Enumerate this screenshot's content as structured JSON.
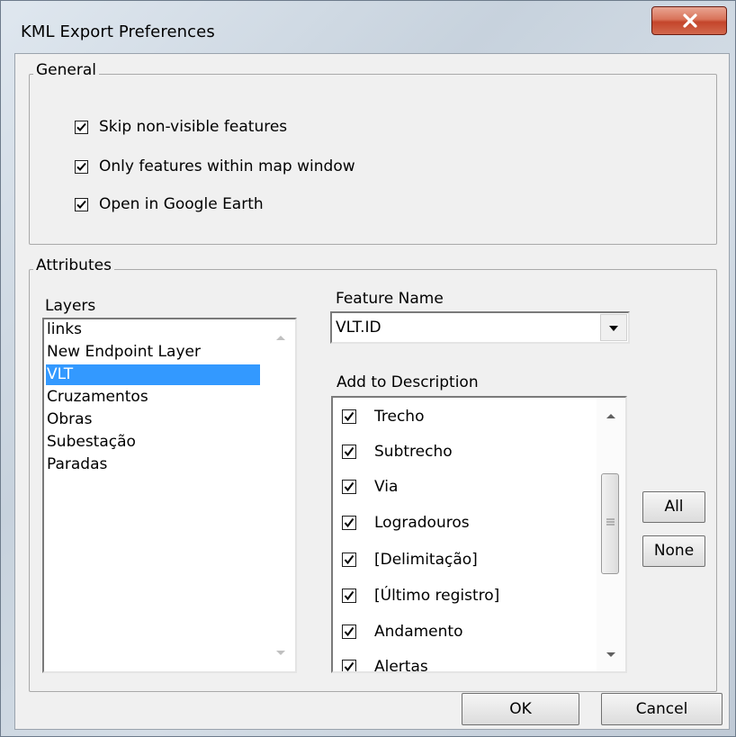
{
  "window": {
    "title": "KML Export Preferences"
  },
  "general": {
    "label": "General",
    "options": [
      {
        "label": "Skip non-visible features",
        "checked": true
      },
      {
        "label": "Only features within map window",
        "checked": true
      },
      {
        "label": "Open in Google Earth",
        "checked": true
      }
    ]
  },
  "attributes": {
    "label": "Attributes",
    "layers_label": "Layers",
    "layers": [
      "links",
      "New Endpoint Layer",
      "VLT",
      "Cruzamentos",
      "Obras",
      "Subestação",
      "Paradas"
    ],
    "selected_layer": "VLT",
    "feature_name_label": "Feature Name",
    "feature_name_value": "VLT.ID",
    "description_label": "Add to Description",
    "description_items": [
      {
        "label": "Trecho",
        "checked": true
      },
      {
        "label": "Subtrecho",
        "checked": true
      },
      {
        "label": "Via",
        "checked": true
      },
      {
        "label": "Logradouros",
        "checked": true
      },
      {
        "label": "[Delimitação]",
        "checked": true
      },
      {
        "label": "[Último registro]",
        "checked": true
      },
      {
        "label": "Andamento",
        "checked": true
      },
      {
        "label": "Alertas",
        "checked": true
      }
    ],
    "all_label": "All",
    "none_label": "None"
  },
  "footer": {
    "ok_label": "OK",
    "cancel_label": "Cancel"
  }
}
